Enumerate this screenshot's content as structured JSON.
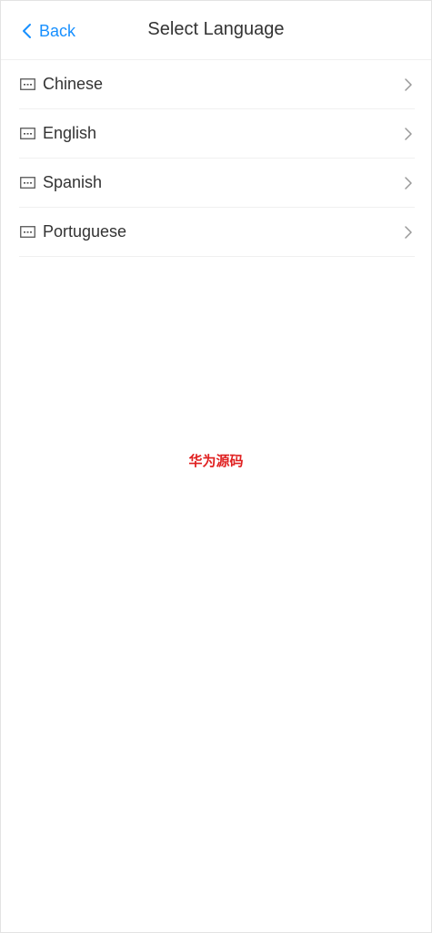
{
  "header": {
    "back_label": "Back",
    "title": "Select Language"
  },
  "languages": [
    {
      "label": "Chinese",
      "icon": "keyboard-icon"
    },
    {
      "label": "English",
      "icon": "keyboard-icon"
    },
    {
      "label": "Spanish",
      "icon": "keyboard-icon"
    },
    {
      "label": "Portuguese",
      "icon": "keyboard-icon"
    }
  ],
  "watermark": "华为源码",
  "colors": {
    "accent": "#1890ff",
    "watermark": "#e02020",
    "divider": "#f0f0f0"
  }
}
